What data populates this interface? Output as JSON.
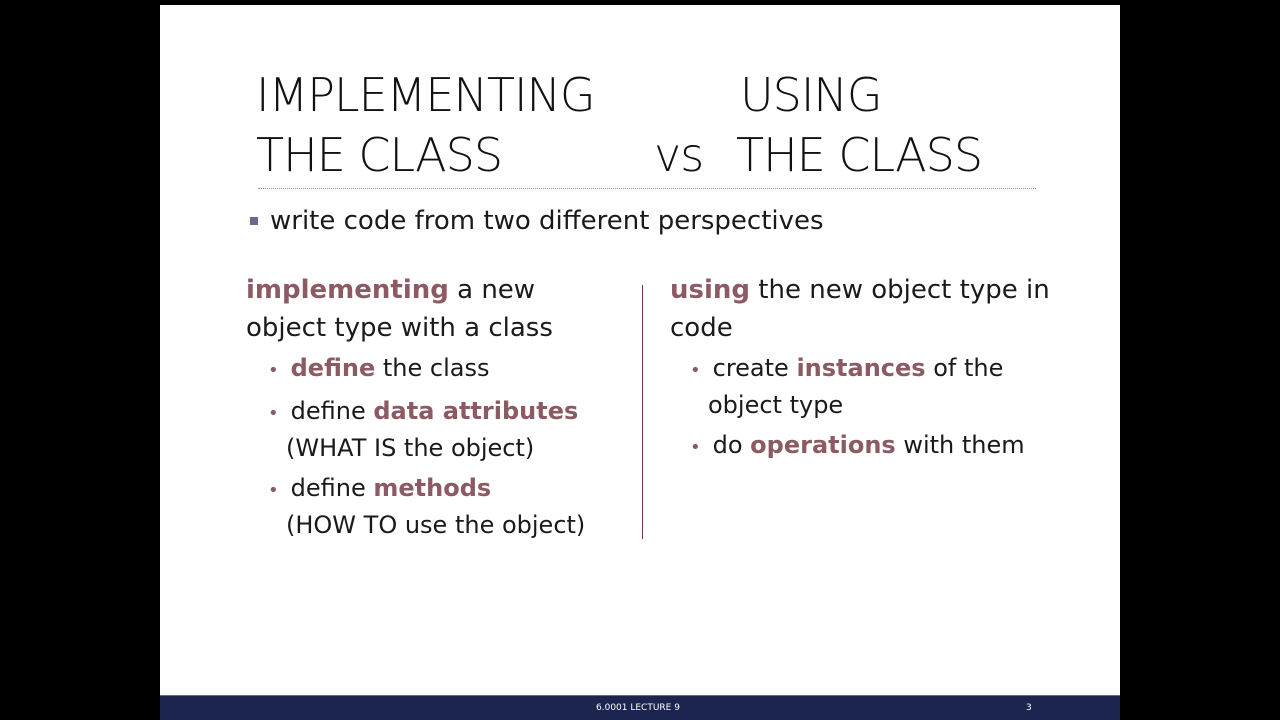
{
  "title": {
    "left_line1": "IMPLEMENTING",
    "left_line2": "THE CLASS",
    "vs": "vs",
    "right_line1": "USING",
    "right_line2": "THE CLASS"
  },
  "intro": "write code from two different perspectives",
  "left": {
    "heading_hl": "implementing",
    "heading_rest1": " a new",
    "heading_line2": "object type with a class",
    "b1_hl": "define",
    "b1_rest": " the class",
    "b2_pre": "define ",
    "b2_hl": "data attributes",
    "b2_sub": "(WHAT IS the object)",
    "b3_pre": "define ",
    "b3_hl": "methods",
    "b3_sub": "(HOW TO use the object)"
  },
  "right": {
    "heading_hl": "using",
    "heading_rest1": " the new object type in",
    "heading_line2": "code",
    "b1_pre": "create ",
    "b1_hl": "instances",
    "b1_rest": " of the",
    "b1_sub": "object type",
    "b2_pre": "do ",
    "b2_hl": "operations",
    "b2_rest": " with them"
  },
  "footer": {
    "label": "6.0001 LECTURE 9",
    "page": "3"
  },
  "colors": {
    "highlight": "#8c5a63",
    "footer": "#1b2550"
  }
}
